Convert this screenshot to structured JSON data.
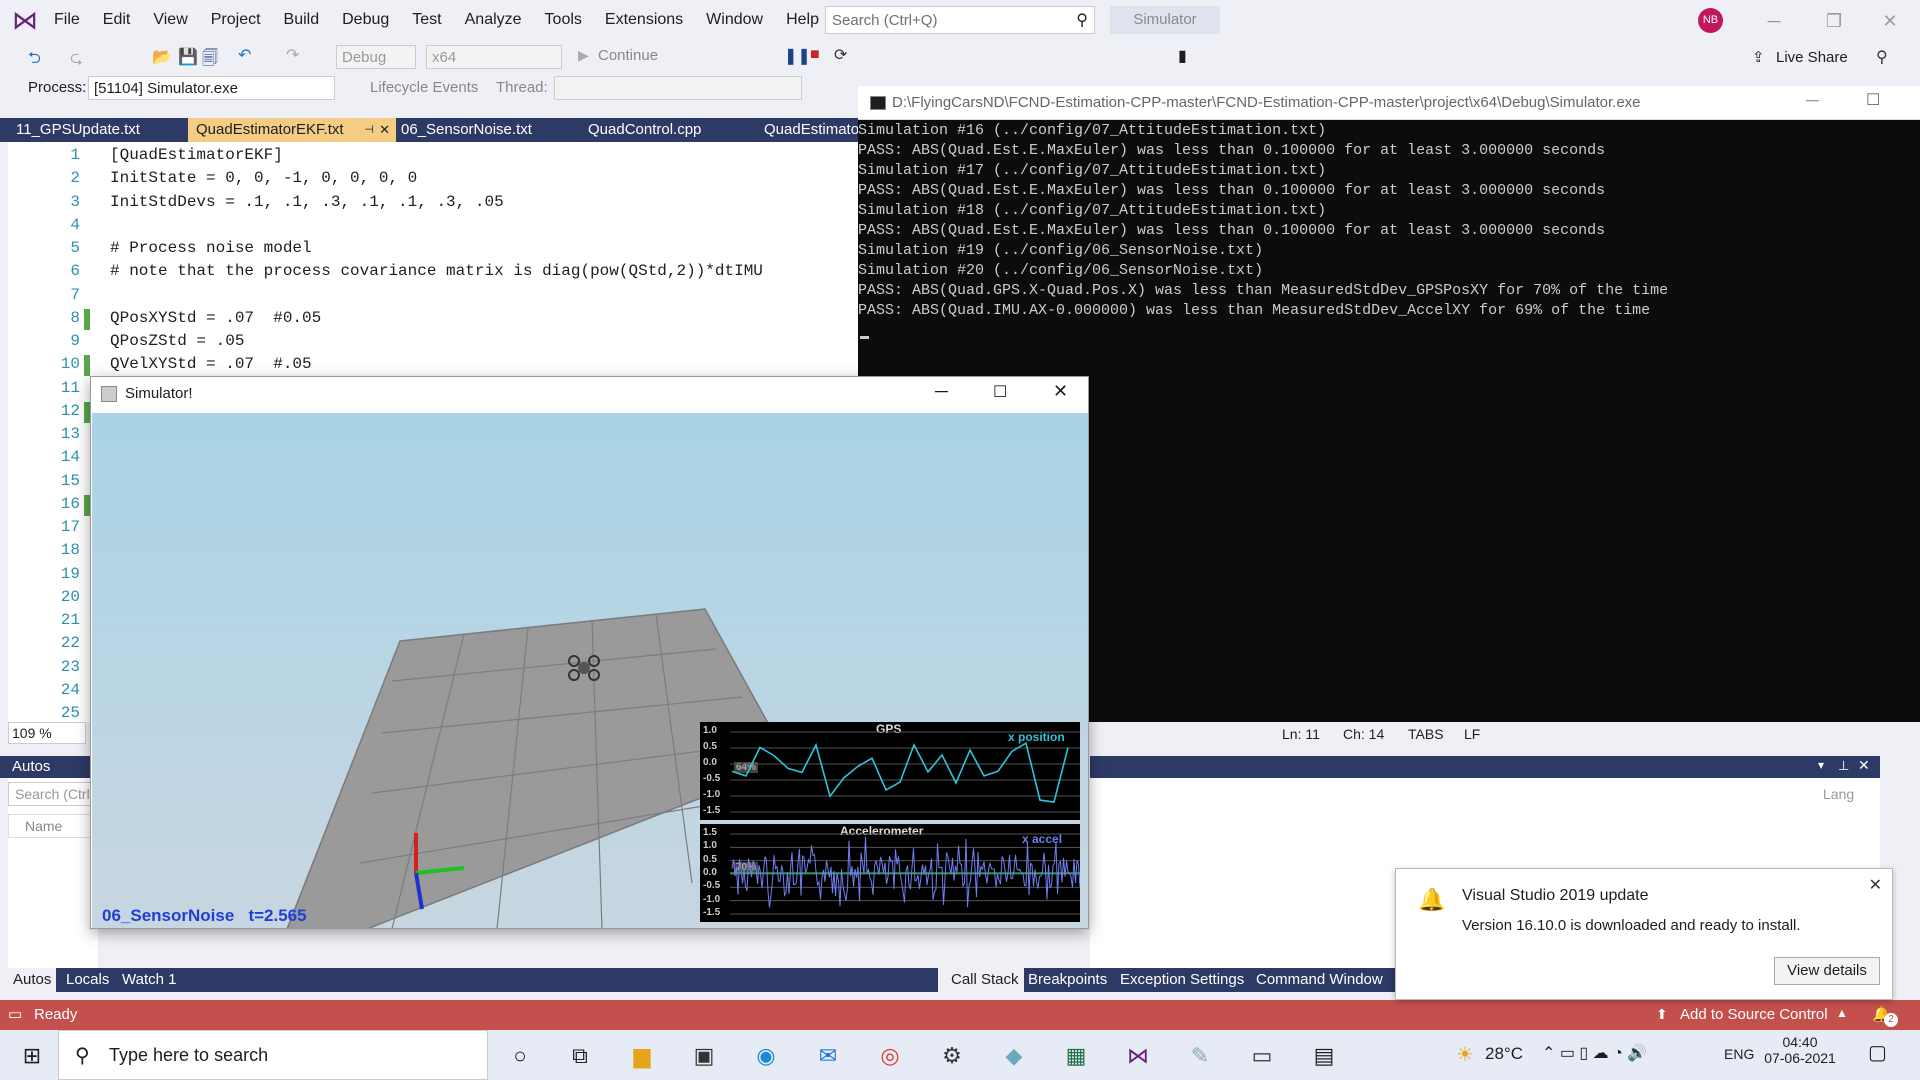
{
  "menu": [
    "File",
    "Edit",
    "View",
    "Project",
    "Build",
    "Debug",
    "Test",
    "Analyze",
    "Tools",
    "Extensions",
    "Window",
    "Help"
  ],
  "search": {
    "placeholder": "Search (Ctrl+Q)"
  },
  "simulator_badge": "Simulator",
  "avatar_initials": "NB",
  "toolbar": {
    "config": "Debug",
    "platform": "x64",
    "continue": "Continue",
    "live_share": "Live Share"
  },
  "process": {
    "label": "Process:",
    "value": "[51104] Simulator.exe",
    "lifecycle": "Lifecycle Events",
    "thread": "Thread:"
  },
  "tabs": [
    {
      "label": "11_GPSUpdate.txt"
    },
    {
      "label": "QuadEstimatorEKF.txt"
    },
    {
      "label": "06_SensorNoise.txt"
    },
    {
      "label": "QuadControl.cpp"
    },
    {
      "label": "QuadEstimato"
    }
  ],
  "editor": {
    "lines": [
      {
        "n": "1",
        "text": "[QuadEstimatorEKF]"
      },
      {
        "n": "2",
        "text": "InitState = 0, 0, -1, 0, 0, 0, 0"
      },
      {
        "n": "3",
        "text": "InitStdDevs = .1, .1, .3, .1, .1, .3, .05"
      },
      {
        "n": "4",
        "text": ""
      },
      {
        "n": "5",
        "text": "# Process noise model"
      },
      {
        "n": "6",
        "text": "# note that the process covariance matrix is diag(pow(QStd,2))*dtIMU"
      },
      {
        "n": "7",
        "text": ""
      },
      {
        "n": "8",
        "text": "QPosXYStd = .07  #0.05"
      },
      {
        "n": "9",
        "text": "QPosZStd = .05"
      },
      {
        "n": "10",
        "text": "QVelXYStd = .07  #.05"
      },
      {
        "n": "11",
        "text": ""
      },
      {
        "n": "12",
        "text": ""
      },
      {
        "n": "13",
        "text": ""
      },
      {
        "n": "14",
        "text": ""
      },
      {
        "n": "15",
        "text": ""
      },
      {
        "n": "16",
        "text": ""
      },
      {
        "n": "17",
        "text": ""
      },
      {
        "n": "18",
        "text": ""
      },
      {
        "n": "19",
        "text": ""
      },
      {
        "n": "20",
        "text": ""
      },
      {
        "n": "21",
        "text": ""
      },
      {
        "n": "22",
        "text": ""
      },
      {
        "n": "23",
        "text": ""
      },
      {
        "n": "24",
        "text": ""
      },
      {
        "n": "25",
        "text": ""
      }
    ],
    "zoom": "109 %",
    "status": {
      "ln": "Ln: 11",
      "ch": "Ch: 14",
      "tabs": "TABS",
      "lf": "LF"
    }
  },
  "console": {
    "title": "D:\\FlyingCarsND\\FCND-Estimation-CPP-master\\FCND-Estimation-CPP-master\\project\\x64\\Debug\\Simulator.exe",
    "lines": [
      "Simulation #16 (../config/07_AttitudeEstimation.txt)",
      "PASS: ABS(Quad.Est.E.MaxEuler) was less than 0.100000 for at least 3.000000 seconds",
      "Simulation #17 (../config/07_AttitudeEstimation.txt)",
      "PASS: ABS(Quad.Est.E.MaxEuler) was less than 0.100000 for at least 3.000000 seconds",
      "Simulation #18 (../config/07_AttitudeEstimation.txt)",
      "PASS: ABS(Quad.Est.E.MaxEuler) was less than 0.100000 for at least 3.000000 seconds",
      "Simulation #19 (../config/06_SensorNoise.txt)",
      "Simulation #20 (../config/06_SensorNoise.txt)",
      "PASS: ABS(Quad.GPS.X-Quad.Pos.X) was less than MeasuredStdDev_GPSPosXY for 70% of the time",
      "PASS: ABS(Quad.IMU.AX-0.000000) was less than MeasuredStdDev_AccelXY for 69% of the time"
    ]
  },
  "simulator": {
    "title": "Simulator!",
    "label": "06_SensorNoise   t=2.565",
    "gps_plot": {
      "title": "GPS",
      "series": "x position",
      "badge": "64%",
      "yticks": [
        "1.0",
        "0.5",
        "0.0",
        "-0.5",
        "-1.0",
        "-1.5"
      ]
    },
    "acc_plot": {
      "title": "Accelerometer",
      "series": "x accel",
      "badge": "70%",
      "yticks": [
        "1.5",
        "1.0",
        "0.5",
        "0.0",
        "-0.5",
        "-1.0",
        "-1.5"
      ]
    }
  },
  "autos": {
    "title": "Autos",
    "search": "Search (Ctrl",
    "col": "Name"
  },
  "lower_tabs_left": [
    "Autos",
    "Locals",
    "Watch 1"
  ],
  "lower_tabs_right": [
    "Call Stack",
    "Breakpoints",
    "Exception Settings",
    "Command Window"
  ],
  "lang_col": "Lang",
  "status": {
    "ready": "Ready",
    "source_control": "Add to Source Control",
    "badge": "2"
  },
  "toast": {
    "title": "Visual Studio 2019 update",
    "body": "Version 16.10.0 is downloaded and ready to install.",
    "button": "View details"
  },
  "taskbar": {
    "search": "Type here to search",
    "temp": "28°C",
    "lang": "ENG",
    "time": "04:40",
    "date": "07-06-2021"
  },
  "colors": {
    "vs_tab_bar": "#2d3a66",
    "active_tab": "#f5cc84",
    "status_bar": "#c4504d",
    "console_bg": "#0c0c0c",
    "sim_label": "#1f3fd6"
  }
}
